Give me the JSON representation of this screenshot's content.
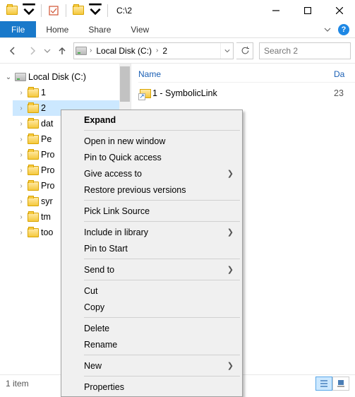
{
  "titlebar": {
    "path": "C:\\2"
  },
  "ribbon": {
    "file": "File",
    "tabs": [
      "Home",
      "Share",
      "View"
    ]
  },
  "breadcrumb": {
    "drive": "Local Disk (C:)",
    "folder": "2"
  },
  "search": {
    "placeholder": "Search 2"
  },
  "tree": {
    "root": "Local Disk (C:)",
    "children": [
      "1",
      "2",
      "dat",
      "Pe",
      "Pro",
      "Pro",
      "Pro",
      "syr",
      "tm",
      "too"
    ]
  },
  "columns": {
    "name": "Name",
    "date": "Da"
  },
  "files": [
    {
      "name": "1 - SymbolicLink",
      "date": "23"
    }
  ],
  "status": {
    "count": "1 item"
  },
  "context_menu": {
    "expand": "Expand",
    "open_new": "Open in new window",
    "pin_quick": "Pin to Quick access",
    "give_access": "Give access to",
    "restore": "Restore previous versions",
    "pick_link": "Pick Link Source",
    "include_lib": "Include in library",
    "pin_start": "Pin to Start",
    "send_to": "Send to",
    "cut": "Cut",
    "copy": "Copy",
    "delete": "Delete",
    "rename": "Rename",
    "new": "New",
    "properties": "Properties"
  }
}
